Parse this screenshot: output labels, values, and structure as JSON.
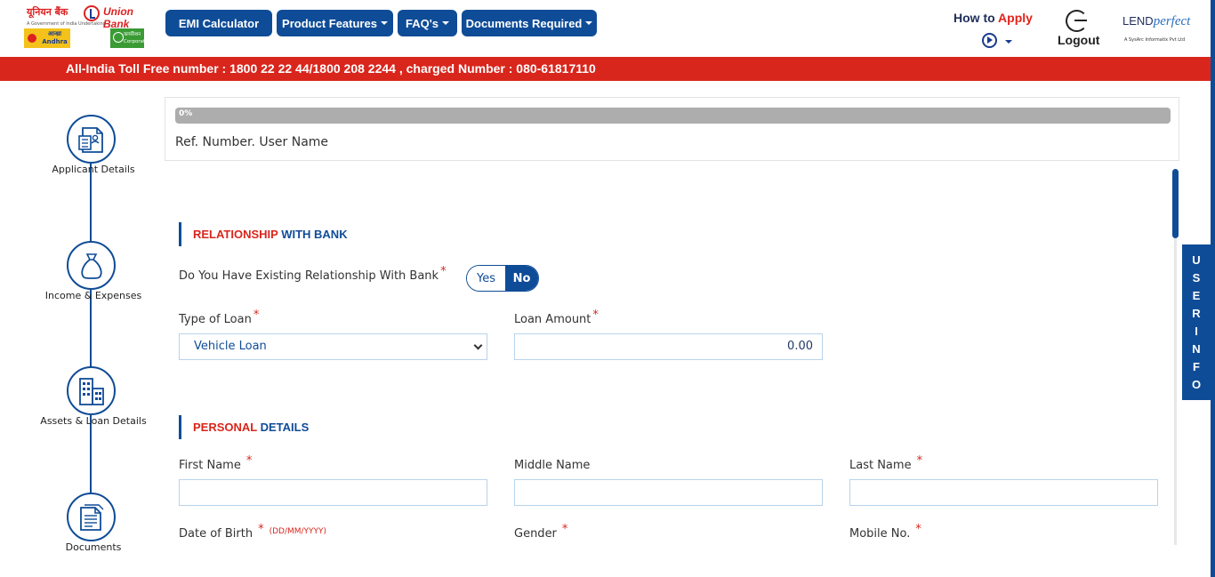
{
  "header": {
    "logo": {
      "hindi_name": "यूनियन बैंक",
      "bank_name": "Union Bank",
      "tagline": "A Government of India Undertaking",
      "andhra_text": "आन्ध्रा Andhra",
      "corp_text": "कार्पोरेशन Corporation"
    },
    "nav": {
      "emi_label": "EMI Calculator",
      "product_label": "Product Features",
      "faq_label": "FAQ's",
      "docs_label": "Documents Required"
    },
    "how_to_prefix": "How to ",
    "how_to_apply": "Apply",
    "logout_label": "Logout",
    "partner": {
      "lend": "LEND",
      "perfect": "perfect",
      "sub": "A SysArc Informatix Pvt Ltd"
    },
    "icons": {
      "play": "play-circle-icon",
      "logout": "logout-icon",
      "caret": "caret-down-icon"
    }
  },
  "tollbar": {
    "text": "All-India Toll Free number : 1800 22 22 44/1800 208 2244 , charged Number : 080-61817110"
  },
  "sidebar": {
    "steps": [
      {
        "label": "Applicant Details",
        "icon": "applicant-document-icon"
      },
      {
        "label": "Income & Expenses",
        "icon": "money-bag-icon"
      },
      {
        "label": "Assets & Loan Details",
        "icon": "building-icon"
      },
      {
        "label": "Documents",
        "icon": "documents-icon"
      }
    ]
  },
  "progress": {
    "percent_label": "0%",
    "fraction": 0,
    "ref_text": "Ref. Number. User Name"
  },
  "relationship_section": {
    "title_red": "RELATIONSHIP",
    "title_blue": " WITH BANK",
    "question": "Do You Have Existing Relationship With Bank",
    "yes_label": "Yes",
    "no_label": "No",
    "selected": "No",
    "loan_type_label": "Type of Loan",
    "loan_type_value": "Vehicle Loan",
    "loan_amount_label": "Loan Amount",
    "loan_amount_value": "0.00"
  },
  "personal_section": {
    "title_red": "PERSONAL",
    "title_blue": " DETAILS",
    "first_name_label": "First Name",
    "first_name_value": "",
    "middle_name_label": "Middle Name",
    "middle_name_value": "",
    "last_name_label": "Last Name",
    "last_name_value": "",
    "dob_label": "Date of Birth",
    "dob_hint": "(DD/MM/YYYY)",
    "gender_label": "Gender",
    "mobile_label": "Mobile No."
  },
  "required_marker": "*",
  "user_info_tab": [
    "U",
    "S",
    "E",
    "R",
    "I",
    "N",
    "F",
    "O"
  ],
  "colors": {
    "brand_blue": "#0f4c97",
    "brand_red": "#d9261c",
    "progress_track": "#adadad"
  }
}
